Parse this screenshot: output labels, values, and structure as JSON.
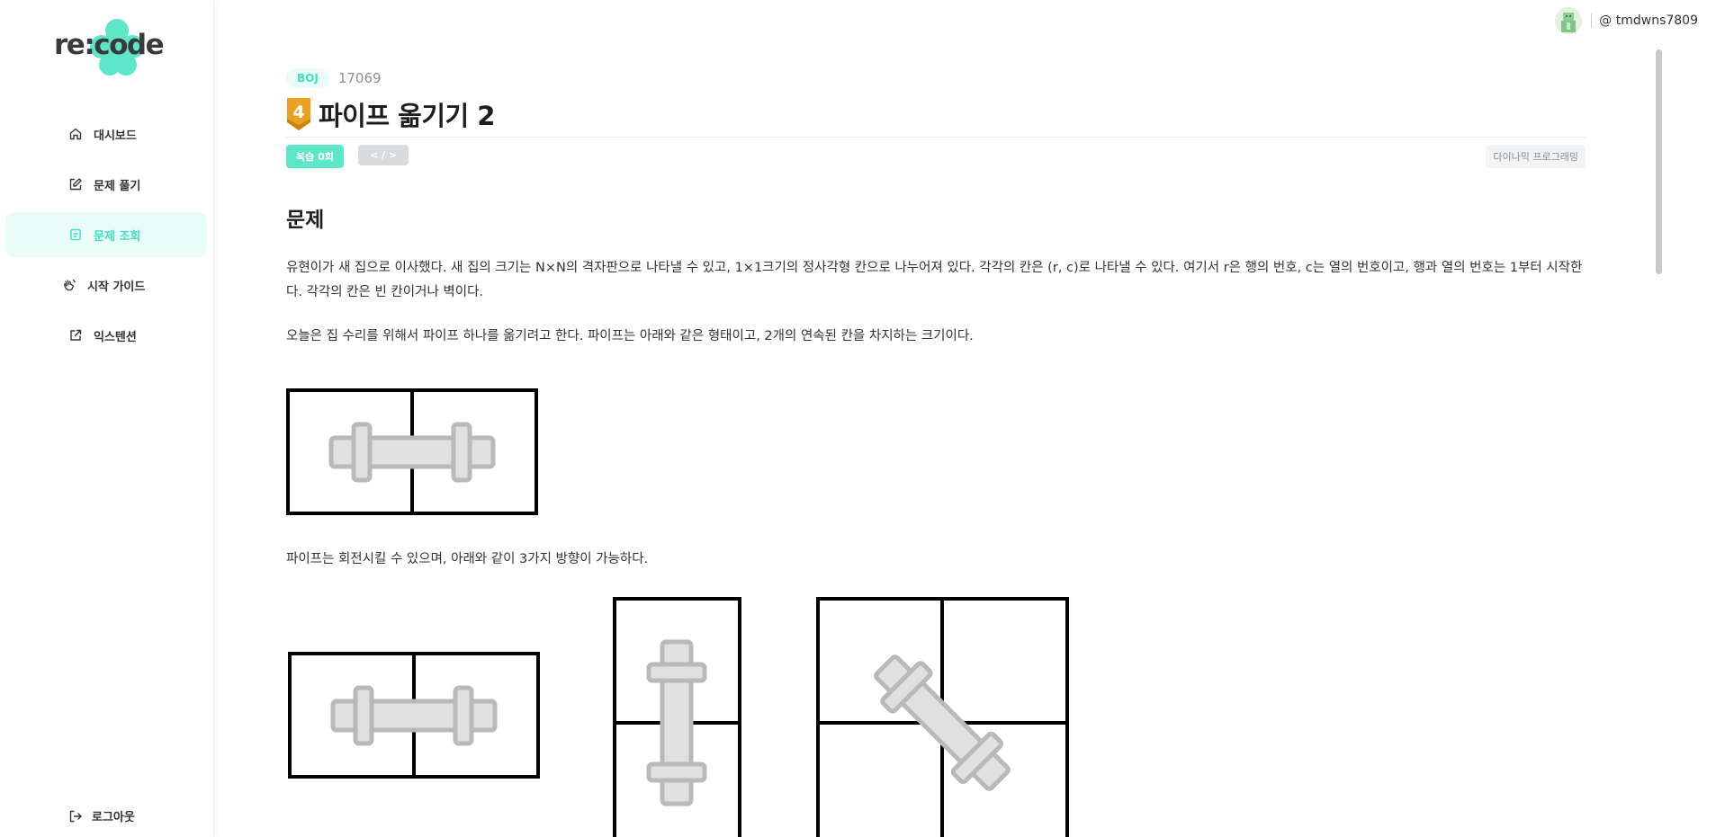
{
  "app": {
    "logo_text": "re:code",
    "brand_color": "#3ee0bf",
    "logo_blob_color": "#5ee6c9"
  },
  "sidebar": {
    "items": [
      {
        "label": "대시보드",
        "icon": "home-icon",
        "active": false
      },
      {
        "label": "문제 풀기",
        "icon": "edit-icon",
        "active": false
      },
      {
        "label": "문제 조회",
        "icon": "document-icon",
        "active": true
      },
      {
        "label": "시작 가이드",
        "icon": "wave-hand-icon",
        "active": false
      },
      {
        "label": "익스텐션",
        "icon": "external-link-icon",
        "active": false
      }
    ],
    "logout_label": "로그아웃"
  },
  "topbar": {
    "username": "@ tmdwns7809",
    "avatar_icon": "user-avatar"
  },
  "problem": {
    "source": "BOJ",
    "number": "17069",
    "tier": "4",
    "tier_color": "#e9a11f",
    "title": "파이프 옮기기 2",
    "review_label": "복습 0회",
    "code_label": "< / >",
    "algorithm_tag": "다이나믹 프로그래밍",
    "section_title": "문제",
    "paragraphs": [
      "유현이가 새 집으로 이사했다. 새 집의 크기는 N×N의 격자판으로 나타낼 수 있고, 1×1크기의 정사각형 칸으로 나누어져 있다. 각각의 칸은 (r, c)로 나타낼 수 있다. 여기서 r은 행의 번호, c는 열의 번호이고, 행과 열의 번호는 1부터 시작한다. 각각의 칸은 빈 칸이거나 벽이다.",
      "오늘은 집 수리를 위해서 파이프 하나를 옮기려고 한다. 파이프는 아래와 같은 형태이고, 2개의 연속된 칸을 차지하는 크기이다.",
      "파이프는 회전시킬 수 있으며, 아래와 같이 3가지 방향이 가능하다."
    ]
  }
}
